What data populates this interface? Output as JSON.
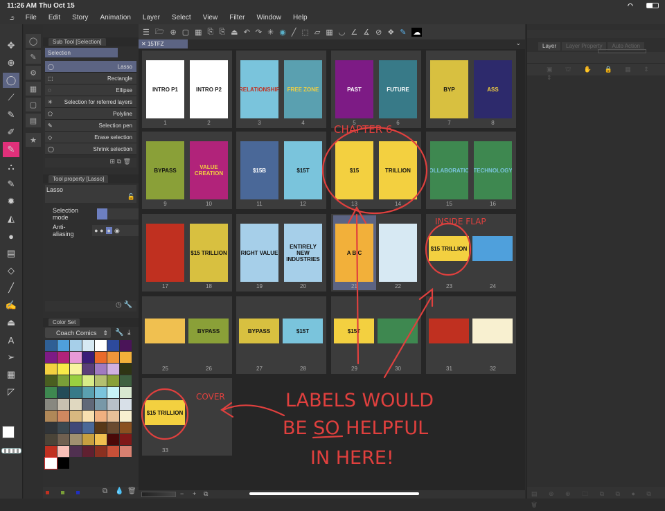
{
  "status": {
    "time": "11:26 AM",
    "date": "Thu Oct 15"
  },
  "menu": [
    "File",
    "Edit",
    "Story",
    "Animation",
    "Layer",
    "Select",
    "View",
    "Filter",
    "Window",
    "Help"
  ],
  "subtool": {
    "header": "Sub Tool [Selection]",
    "group": "Selection",
    "items": [
      "Lasso",
      "Rectangle",
      "Ellipse",
      "Selection for referred layers",
      "Polyline",
      "Selection pen",
      "Erase selection",
      "Shrink selection"
    ],
    "selected": 0
  },
  "toolprop": {
    "header": "Tool property [Lasso]",
    "name": "Lasso",
    "selection_mode": "Selection mode",
    "anti_aliasing": "Anti-aliasing"
  },
  "colorset": {
    "header": "Color Set",
    "set_name": "Coach Comics",
    "colors": [
      "#2f5f95",
      "#4fa0dc",
      "#a6cfe9",
      "#d7e9f3",
      "#ffffff",
      "#2d4a9c",
      "#4a1458",
      "#7d1b85",
      "#b1237a",
      "#e89ad8",
      "#3a1c78",
      "#ea6a2a",
      "#f0963a",
      "#f2b03a",
      "#f3d040",
      "#f8ea48",
      "#f8f4a0",
      "#5a3e78",
      "#a07ac0",
      "#d0b0e0",
      "#2f3514",
      "#4a5e20",
      "#7a9e38",
      "#9ad040",
      "#d8ec88",
      "#b4c070",
      "#8aa038",
      "#3e6040",
      "#3e8850",
      "#244c58",
      "#387a88",
      "#5aa0b0",
      "#7ac4dc",
      "#c8f4f8",
      "#d8e8d0",
      "#888880",
      "#c8c0b0",
      "#e0d8c0",
      "#606878",
      "#7898a8",
      "#b8c0c8",
      "#d8e0e8",
      "#b08858",
      "#d08860",
      "#d8b880",
      "#f8e0b0",
      "#f0b080",
      "#e8c098",
      "#f8f0d0",
      "#303438",
      "#3c4850",
      "#404878",
      "#4a6898",
      "#583818",
      "#6a4a30",
      "#8a5020",
      "#4a4438",
      "#706050",
      "#a09070",
      "#c8a040",
      "#f0c050",
      "#4a0808",
      "#801818",
      "#c03020",
      "#f8c0b8",
      "#503050",
      "#602030",
      "#8a3020",
      "#c85038",
      "#d88070",
      "#ffffff",
      "#000000"
    ]
  },
  "canvas": {
    "tab": "15TFZ",
    "selected_page": 21
  },
  "layer_panel": {
    "tabs": [
      "Layer",
      "Layer Property",
      "Auto Action"
    ]
  },
  "pages": [
    {
      "n": "1",
      "label": "INTRO P1",
      "bg": "#ffffff",
      "fg": "#222"
    },
    {
      "n": "2",
      "label": "INTRO P2",
      "bg": "#ffffff",
      "fg": "#222"
    },
    {
      "n": "3",
      "label": "RELATIONSHIP",
      "bg": "#7ac4dc",
      "fg": "#c03020"
    },
    {
      "n": "4",
      "label": "FREE ZONE",
      "bg": "#5aa0b0",
      "fg": "#f3d040"
    },
    {
      "n": "5",
      "label": "PAST",
      "bg": "#7d1b85",
      "fg": "#fff"
    },
    {
      "n": "6",
      "label": "FUTURE",
      "bg": "#387a88",
      "fg": "#fff"
    },
    {
      "n": "7",
      "label": "BYP",
      "bg": "#d8c040",
      "fg": "#111"
    },
    {
      "n": "8",
      "label": "ASS",
      "bg": "#2d2a6c",
      "fg": "#f3d040"
    },
    {
      "n": "9",
      "label": "BYPASS",
      "bg": "#8aa038",
      "fg": "#111"
    },
    {
      "n": "10",
      "label": "VALUE CREATION",
      "bg": "#b1237a",
      "fg": "#f3d040"
    },
    {
      "n": "11",
      "label": "$15B",
      "bg": "#4a6898",
      "fg": "#fff"
    },
    {
      "n": "12",
      "label": "$15T",
      "bg": "#7ac4dc",
      "fg": "#111"
    },
    {
      "n": "13",
      "label": "$15",
      "bg": "#f3d040",
      "fg": "#111"
    },
    {
      "n": "14",
      "label": "TRILLION",
      "bg": "#f3d040",
      "fg": "#111"
    },
    {
      "n": "15",
      "label": "COLLABORATION",
      "bg": "#3e8850",
      "fg": "#7ac4dc"
    },
    {
      "n": "16",
      "label": "TECHNOLOGY",
      "bg": "#3e8850",
      "fg": "#7ac4dc"
    },
    {
      "n": "17",
      "label": "",
      "bg": "#c03020",
      "fg": "#fff"
    },
    {
      "n": "18",
      "label": "$15 TRILLION",
      "bg": "#d8c040",
      "fg": "#111"
    },
    {
      "n": "19",
      "label": "RIGHT VALUE",
      "bg": "#a6cfe9",
      "fg": "#111"
    },
    {
      "n": "20",
      "label": "ENTIRELY NEW INDUSTRIES",
      "bg": "#a6cfe9",
      "fg": "#111"
    },
    {
      "n": "21",
      "label": "A B C",
      "bg": "#f2b03a",
      "fg": "#111"
    },
    {
      "n": "22",
      "label": "",
      "bg": "#d7e9f3",
      "fg": "#111"
    },
    {
      "n": "23",
      "label": "$15 TRILLION",
      "bg": "#f3d040",
      "fg": "#111",
      "land": true
    },
    {
      "n": "24",
      "label": "",
      "bg": "#4fa0dc",
      "fg": "#111",
      "land": true
    },
    {
      "n": "25",
      "label": "",
      "bg": "#f0c050",
      "fg": "#111",
      "land": true
    },
    {
      "n": "26",
      "label": "BYPASS",
      "bg": "#8aa038",
      "fg": "#111",
      "land": true
    },
    {
      "n": "27",
      "label": "BYPASS",
      "bg": "#d8c040",
      "fg": "#111",
      "land": true
    },
    {
      "n": "28",
      "label": "$15T",
      "bg": "#7ac4dc",
      "fg": "#111",
      "land": true
    },
    {
      "n": "29",
      "label": "$15T",
      "bg": "#f3d040",
      "fg": "#111",
      "land": true
    },
    {
      "n": "30",
      "label": "",
      "bg": "#3e8850",
      "fg": "#111",
      "land": true
    },
    {
      "n": "31",
      "label": "",
      "bg": "#c03020",
      "fg": "#fff",
      "land": true
    },
    {
      "n": "32",
      "label": "",
      "bg": "#f8f0d0",
      "fg": "#111",
      "land": true
    },
    {
      "n": "33",
      "label": "$15 TRILLION",
      "bg": "#f3d040",
      "fg": "#111",
      "land": true
    }
  ],
  "annotations": {
    "chapter": "CHAPTER 6",
    "inside_flap": "INSIDE FLAP",
    "cover": "COVER",
    "note_line1": "LABELS WOULD",
    "note_line2": "BE SO HELPFUL",
    "note_line3": "IN HERE!",
    "color": "#e0403e"
  }
}
